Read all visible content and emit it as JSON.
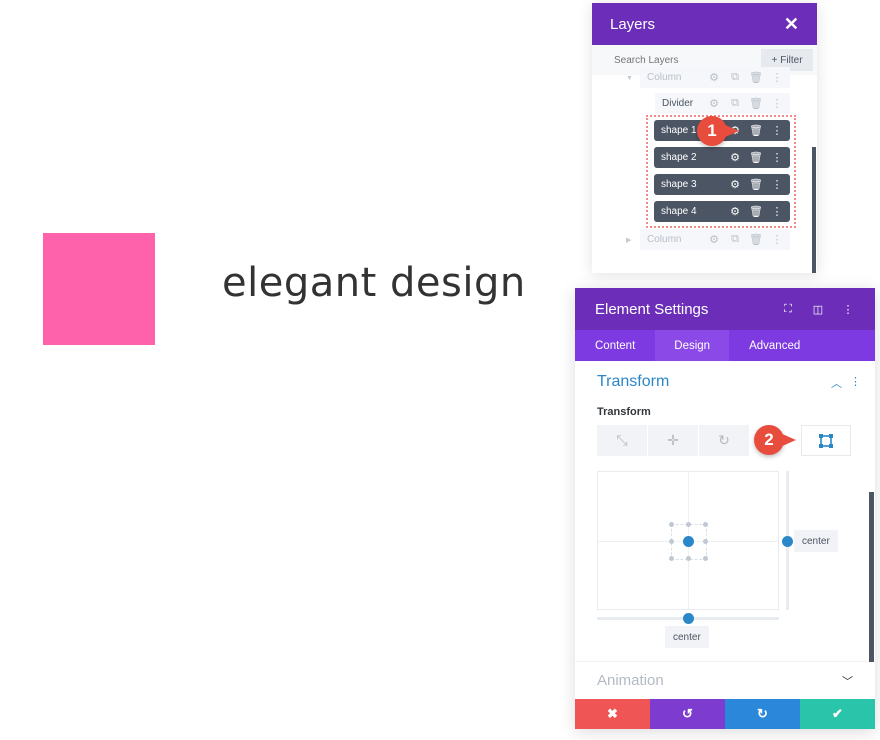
{
  "canvas": {
    "shape_color": "#fd62aa",
    "heading": "elegant design"
  },
  "layers_panel": {
    "title": "Layers",
    "close_icon": "close-icon",
    "search_placeholder": "Search Layers",
    "filter_label": "Filter",
    "rows": [
      {
        "label": "Column",
        "state": "faded"
      },
      {
        "label": "Divider",
        "state": "normal"
      },
      {
        "label": "shape 1",
        "state": "selected"
      },
      {
        "label": "shape 2",
        "state": "selected"
      },
      {
        "label": "shape 3",
        "state": "selected"
      },
      {
        "label": "shape 4",
        "state": "selected"
      },
      {
        "label": "Column",
        "state": "faded"
      }
    ]
  },
  "annotations": {
    "badge_1": "1",
    "badge_2": "2"
  },
  "settings_panel": {
    "title": "Element Settings",
    "tabs": [
      {
        "label": "Content",
        "active": false
      },
      {
        "label": "Design",
        "active": true
      },
      {
        "label": "Advanced",
        "active": false
      }
    ],
    "section_title": "Transform",
    "field_label": "Transform",
    "transform_tabs": [
      "scale",
      "translate",
      "rotate",
      "origin"
    ],
    "active_transform_tab": "origin",
    "origin_x": "center",
    "origin_y": "center",
    "collapsed_section": "Animation",
    "footer_buttons": [
      {
        "name": "discard",
        "icon": "✖",
        "color": "#ef5555"
      },
      {
        "name": "undo",
        "icon": "↺",
        "color": "#7e3bd0"
      },
      {
        "name": "redo",
        "icon": "↻",
        "color": "#2b87da"
      },
      {
        "name": "save",
        "icon": "✔",
        "color": "#29c4a9"
      }
    ]
  }
}
